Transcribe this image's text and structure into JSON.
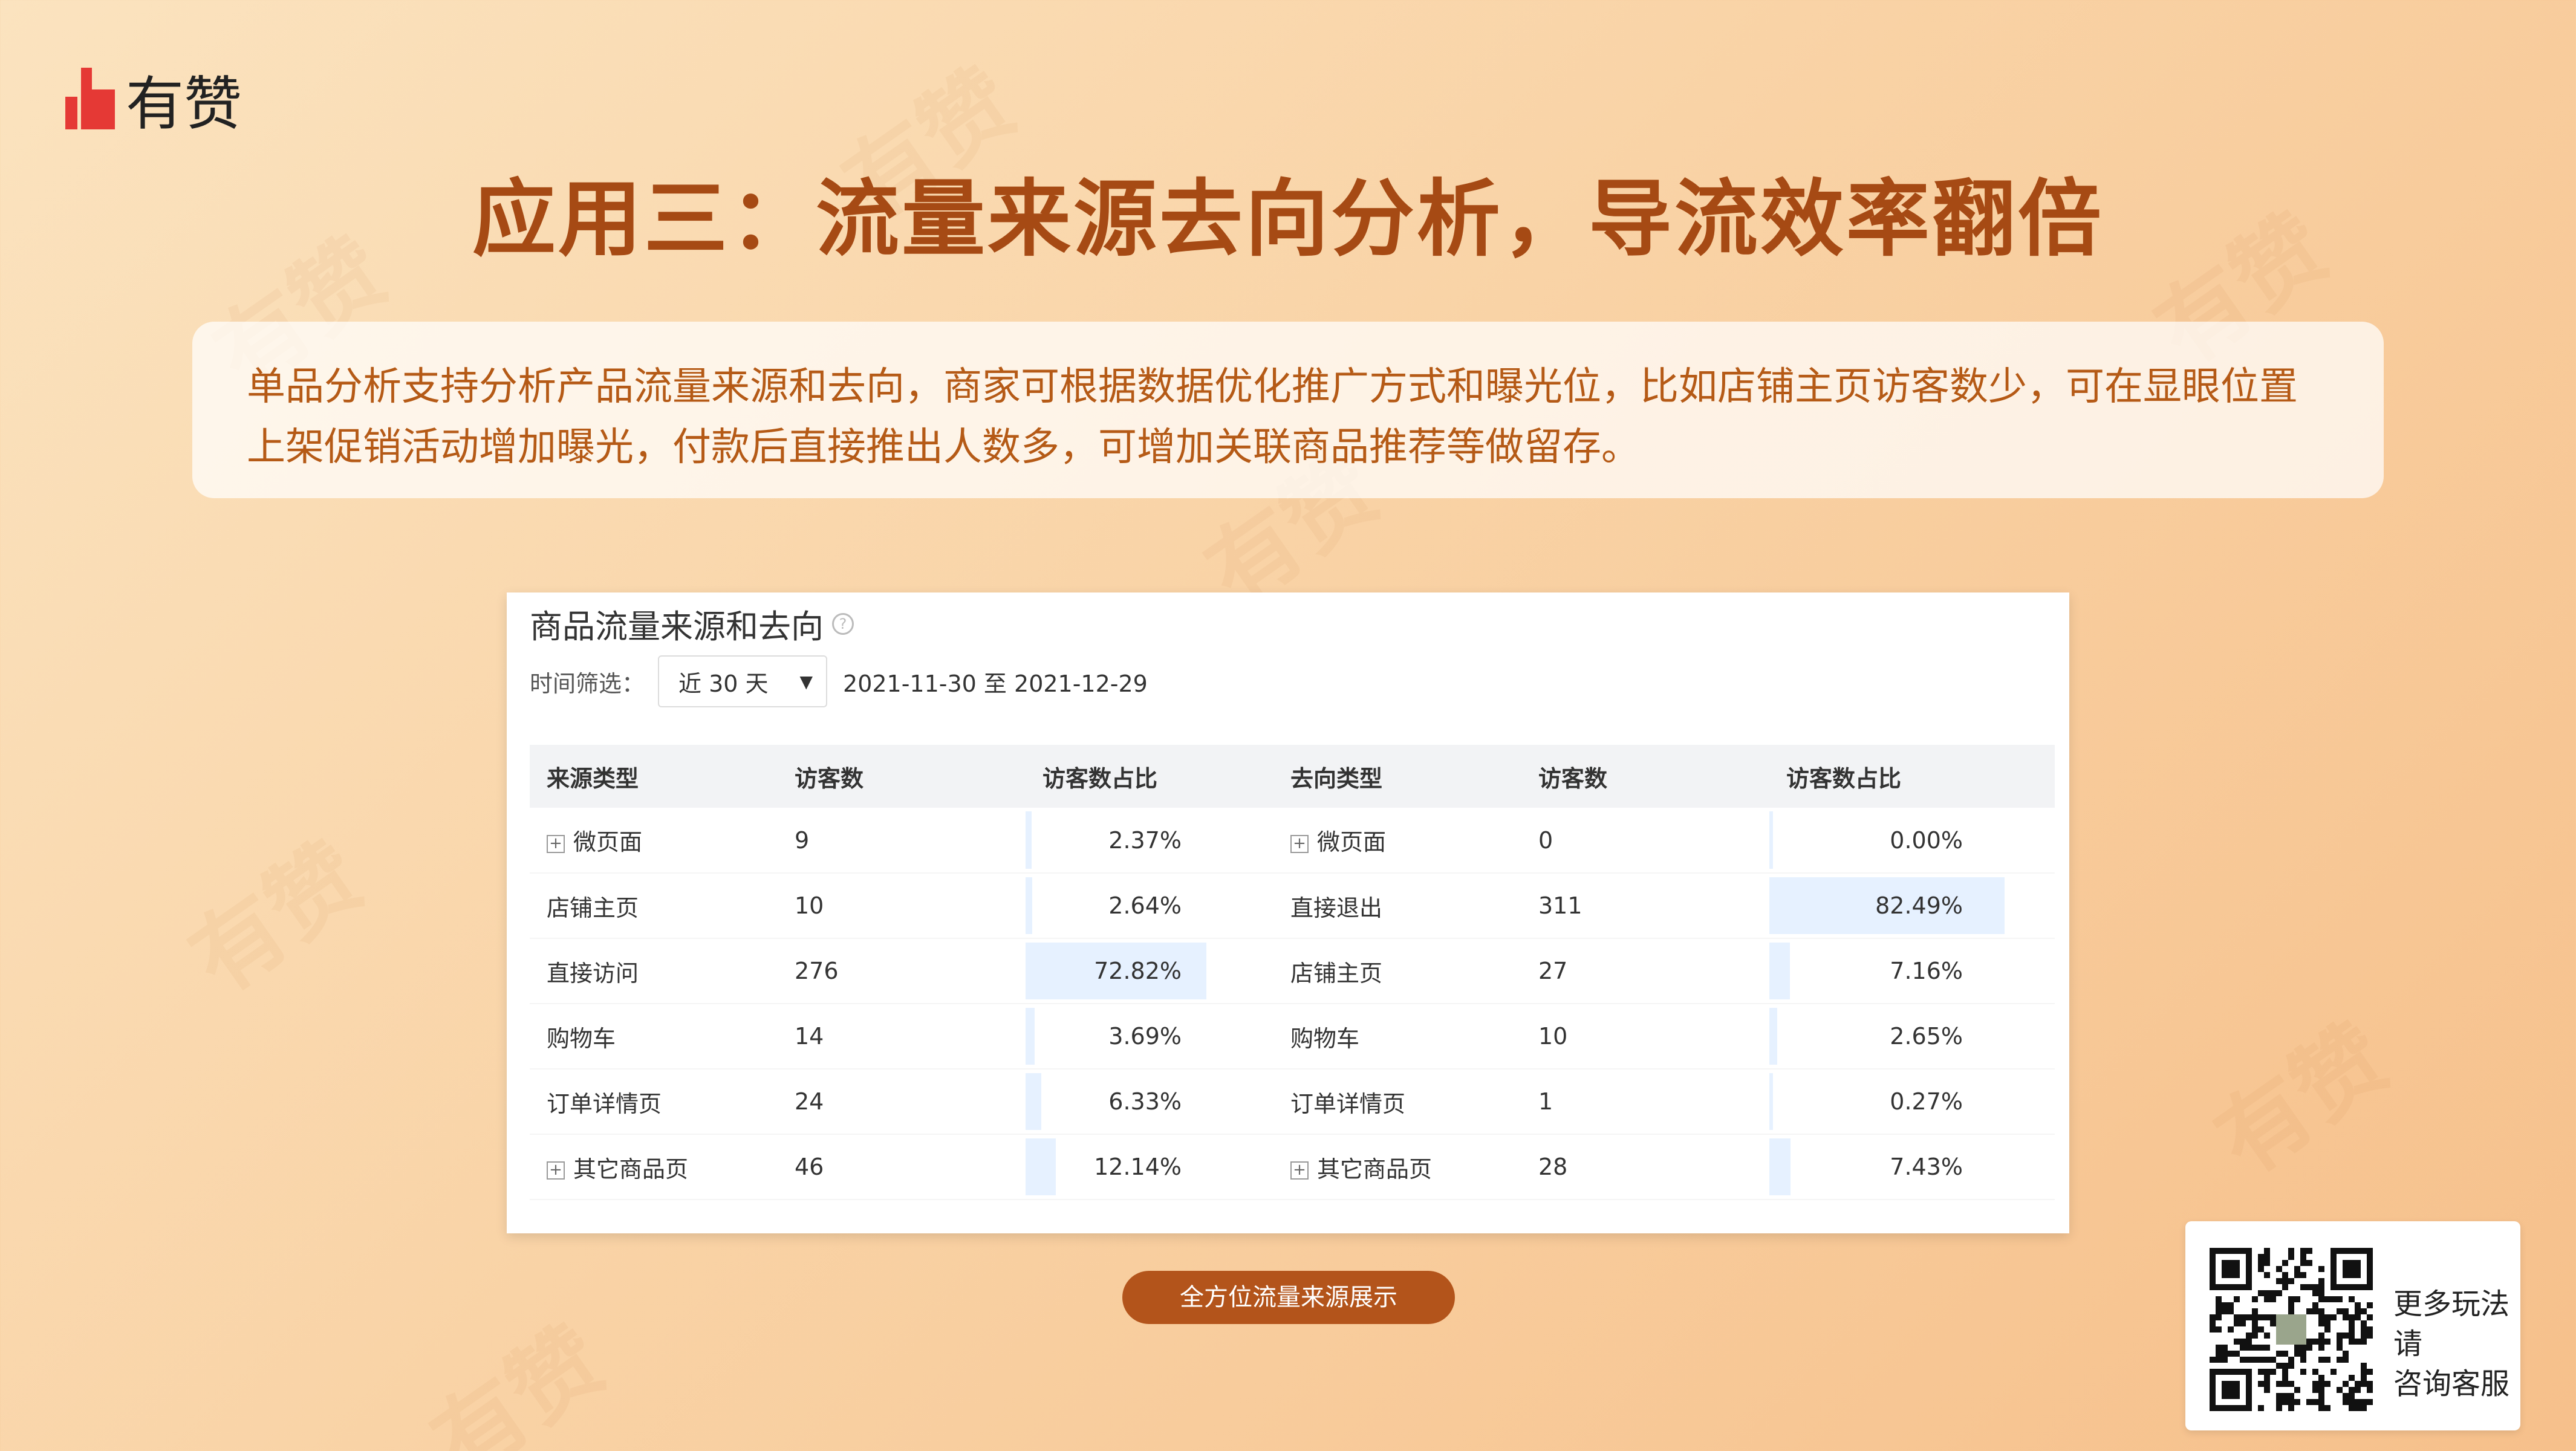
{
  "brand": {
    "name": "有赞",
    "logo_color": "#e53935",
    "watermark_text": "有赞"
  },
  "title": "应用三：流量来源去向分析，导流效率翻倍",
  "description": {
    "line1": "单品分析支持分析产品流量来源和去向，商家可根据数据优化推广方式和曝光位，比如店铺主页访客数少，可在显眼位置",
    "line2": "上架促销活动增加曝光，付款后直接推出人数多，可增加关联商品推荐等做留存。"
  },
  "panel": {
    "title": "商品流量来源和去向",
    "help_icon": "question-circle-icon",
    "filter_label": "时间筛选：",
    "select_value": "近 30 天",
    "date_range": "2021-11-30 至 2021-12-29",
    "headers": [
      "来源类型",
      "访客数",
      "访客数占比",
      "去向类型",
      "访客数",
      "访客数占比"
    ],
    "rows": [
      {
        "src": "微页面",
        "src_expand": true,
        "src_visitors": "9",
        "src_pct": "2.37%",
        "src_pct_value": 2.37,
        "dst": "微页面",
        "dst_expand": true,
        "dst_visitors": "0",
        "dst_pct": "0.00%",
        "dst_pct_value": 0.0
      },
      {
        "src": "店铺主页",
        "src_expand": false,
        "src_visitors": "10",
        "src_pct": "2.64%",
        "src_pct_value": 2.64,
        "dst": "直接退出",
        "dst_expand": false,
        "dst_visitors": "311",
        "dst_pct": "82.49%",
        "dst_pct_value": 82.49
      },
      {
        "src": "直接访问",
        "src_expand": false,
        "src_visitors": "276",
        "src_pct": "72.82%",
        "src_pct_value": 72.82,
        "dst": "店铺主页",
        "dst_expand": false,
        "dst_visitors": "27",
        "dst_pct": "7.16%",
        "dst_pct_value": 7.16
      },
      {
        "src": "购物车",
        "src_expand": false,
        "src_visitors": "14",
        "src_pct": "3.69%",
        "src_pct_value": 3.69,
        "dst": "购物车",
        "dst_expand": false,
        "dst_visitors": "10",
        "dst_pct": "2.65%",
        "dst_pct_value": 2.65
      },
      {
        "src": "订单详情页",
        "src_expand": false,
        "src_visitors": "24",
        "src_pct": "6.33%",
        "src_pct_value": 6.33,
        "dst": "订单详情页",
        "dst_expand": false,
        "dst_visitors": "1",
        "dst_pct": "0.27%",
        "dst_pct_value": 0.27
      },
      {
        "src": "其它商品页",
        "src_expand": true,
        "src_visitors": "46",
        "src_pct": "12.14%",
        "src_pct_value": 12.14,
        "dst": "其它商品页",
        "dst_expand": true,
        "dst_visitors": "28",
        "dst_pct": "7.43%",
        "dst_pct_value": 7.43
      }
    ]
  },
  "cta": "全方位流量来源展示",
  "qr": {
    "text_line1": "更多玩法请",
    "text_line2": "咨询客服",
    "icon": "qr-code-icon"
  },
  "colors": {
    "title": "#a64a14",
    "description": "#b55a16",
    "cta_bg": "#b3541b",
    "bar": "#e6f1ff"
  }
}
